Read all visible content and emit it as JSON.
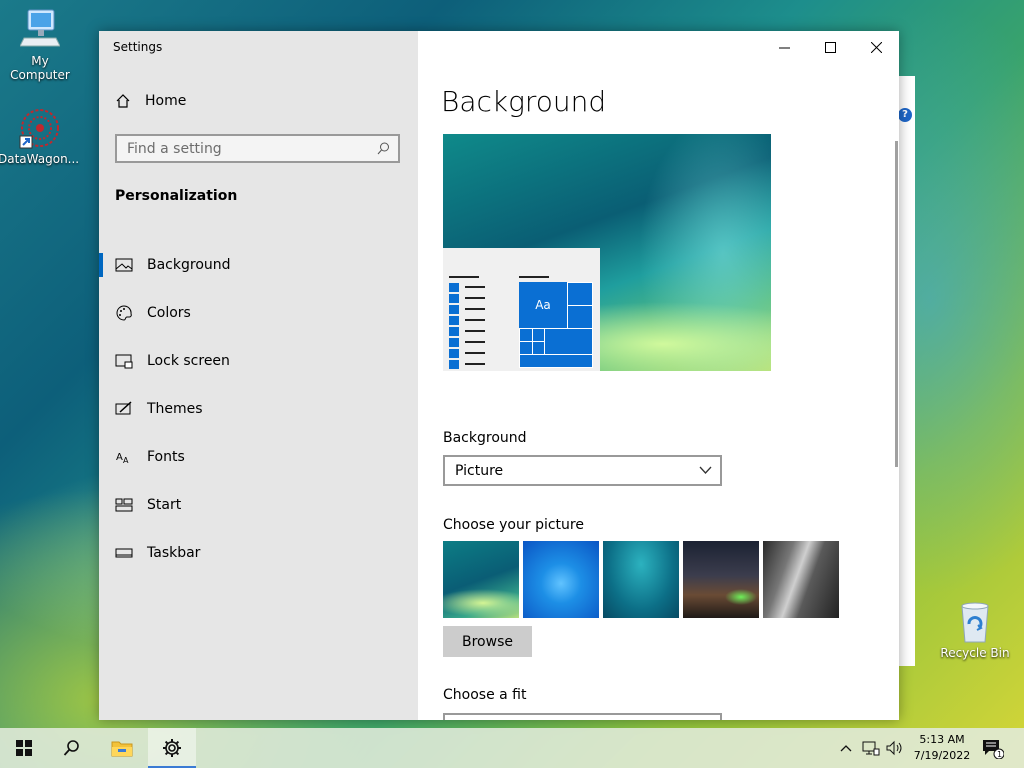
{
  "desktop": {
    "icons": [
      {
        "label": "My Computer"
      },
      {
        "label": "DataWagon..."
      },
      {
        "label": "Recycle Bin"
      }
    ]
  },
  "window": {
    "title": "Settings",
    "home_label": "Home",
    "search_placeholder": "Find a setting",
    "section": "Personalization",
    "nav": [
      {
        "label": "Background",
        "icon": "picture-icon",
        "active": true
      },
      {
        "label": "Colors",
        "icon": "palette-icon"
      },
      {
        "label": "Lock screen",
        "icon": "lock-screen-icon"
      },
      {
        "label": "Themes",
        "icon": "themes-icon"
      },
      {
        "label": "Fonts",
        "icon": "fonts-icon"
      },
      {
        "label": "Start",
        "icon": "start-icon"
      },
      {
        "label": "Taskbar",
        "icon": "taskbar-icon"
      }
    ]
  },
  "main": {
    "title": "Background",
    "preview_tile_text": "Aa",
    "background_label": "Background",
    "background_value": "Picture",
    "choose_picture_label": "Choose your picture",
    "browse_label": "Browse",
    "choose_fit_label": "Choose a fit"
  },
  "taskbar": {
    "time": "5:13 AM",
    "date": "7/19/2022",
    "notification_count": "1"
  },
  "colors": {
    "accent": "#0067c0",
    "tile_blue": "#0a6fd3"
  }
}
